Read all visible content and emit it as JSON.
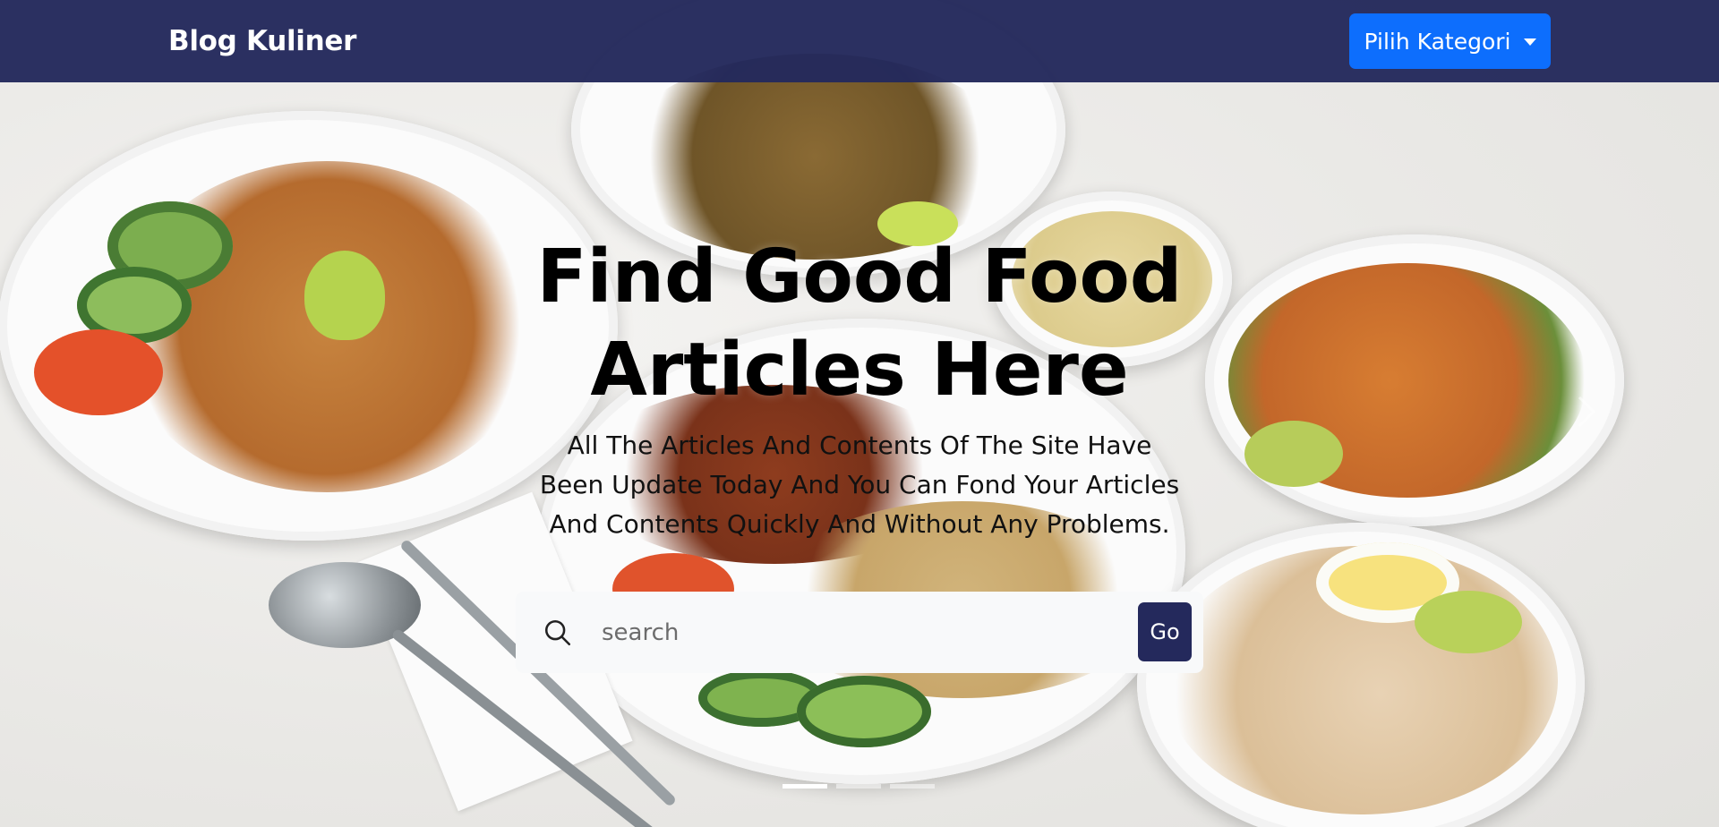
{
  "navbar": {
    "brand": "Blog Kuliner",
    "category_button": "Pilih Kategori"
  },
  "hero": {
    "headline_line1": "Find Good Food",
    "headline_line2": "Articles Here",
    "subtitle": "All The Articles And Contents Of The Site Have Been Update Today And You Can Fond Your Articles And Contents Quickly And Without Any Problems.",
    "image_description": "food-plates-background"
  },
  "search": {
    "placeholder": "search",
    "value": "",
    "button_label": "Go",
    "icon": "search-icon"
  },
  "carousel": {
    "slide_count": 3,
    "active_index": 0,
    "next_icon": "chevron-right-icon"
  },
  "colors": {
    "navbar": "#24295c",
    "primary_button": "#0d6efd",
    "go_button": "#24295c",
    "search_bg": "#f8f9fa"
  }
}
